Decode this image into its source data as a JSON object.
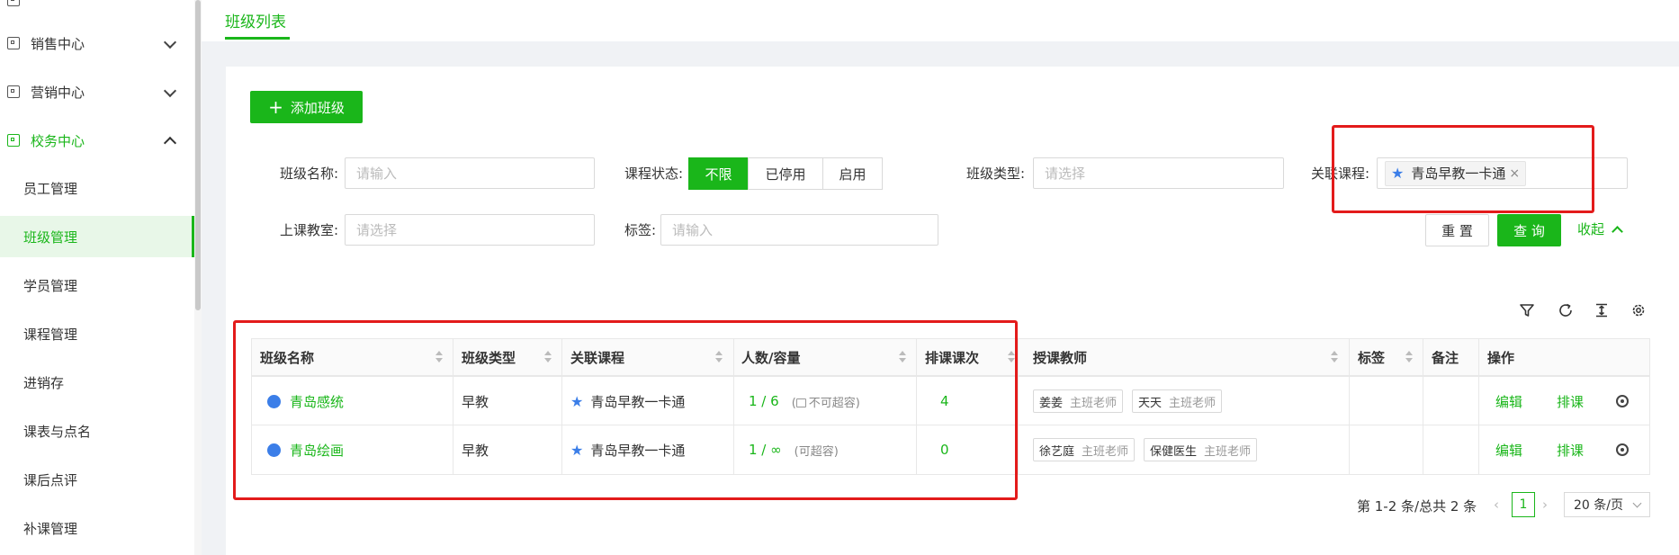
{
  "sidebar": {
    "items": [
      {
        "label": "销售中心",
        "state": "collapsed"
      },
      {
        "label": "营销中心",
        "state": "collapsed"
      },
      {
        "label": "校务中心",
        "state": "expanded"
      }
    ],
    "sub_items": [
      "员工管理",
      "班级管理",
      "学员管理",
      "课程管理",
      "进销存",
      "课表与点名",
      "课后点评",
      "补课管理"
    ],
    "active_sub": "班级管理"
  },
  "tabs": [
    {
      "label": "班级列表",
      "active": true
    }
  ],
  "toolbar": {
    "add_label": "添加班级"
  },
  "filters": {
    "class_name": {
      "label": "班级名称:",
      "placeholder": "请输入"
    },
    "course_status": {
      "label": "课程状态:",
      "options": [
        "不限",
        "已停用",
        "启用"
      ],
      "selected": "不限"
    },
    "class_type": {
      "label": "班级类型:",
      "placeholder": "请选择"
    },
    "related_course": {
      "label": "关联课程:",
      "value": "青岛早教一卡通"
    },
    "classroom": {
      "label": "上课教室:",
      "placeholder": "请选择"
    },
    "tags": {
      "label": "标签:",
      "placeholder": "请输入"
    },
    "reset_label": "重 置",
    "query_label": "查 询",
    "collapse_label": "收起"
  },
  "table": {
    "columns": [
      "班级名称",
      "班级类型",
      "关联课程",
      "人数/容量",
      "排课课次",
      "授课教师",
      "标签",
      "备注",
      "操作"
    ],
    "rows": [
      {
        "name": "青岛感统",
        "type": "早教",
        "course": "青岛早教一卡通",
        "count": "1 / 6",
        "capacity_note": "不可超容",
        "lessons": "4",
        "teachers": [
          {
            "name": "姜姜",
            "role": "主班老师"
          },
          {
            "name": "天天",
            "role": "主班老师"
          }
        ],
        "actions": {
          "edit": "编辑",
          "schedule": "排课"
        }
      },
      {
        "name": "青岛绘画",
        "type": "早教",
        "course": "青岛早教一卡通",
        "count": "1 / ∞",
        "capacity_note": "(可超容)",
        "lessons": "0",
        "teachers": [
          {
            "name": "徐艺庭",
            "role": "主班老师"
          },
          {
            "name": "保健医生",
            "role": "主班老师"
          }
        ],
        "actions": {
          "edit": "编辑",
          "schedule": "排课"
        }
      }
    ]
  },
  "pagination": {
    "total_text": "第 1-2 条/总共 2 条",
    "current_page": "1",
    "page_size": "20 条/页"
  },
  "colors": {
    "accent": "#1ab61a",
    "highlight_box": "#e31b1b",
    "dot": "#3b7ee8"
  },
  "icons": [
    "filter-icon",
    "refresh-icon",
    "column-height-icon",
    "settings-icon"
  ]
}
